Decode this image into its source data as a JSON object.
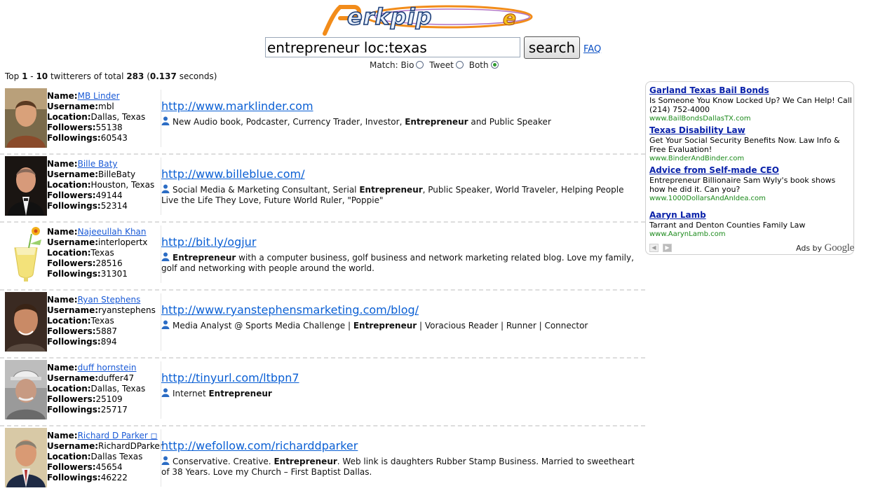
{
  "logo": {
    "text": "perkpipe"
  },
  "search": {
    "value": "entrepreneur loc:texas",
    "button_label": "search",
    "faq_label": "FAQ"
  },
  "match": {
    "label": "Match:",
    "options": [
      "Bio",
      "Tweet",
      "Both"
    ],
    "selected": "Both"
  },
  "summary": {
    "prefix": "Top",
    "start": "1",
    "dash": "-",
    "end": "10",
    "middle": "twitterers of total",
    "total": "283",
    "time": "0.137",
    "suffix": "seconds)"
  },
  "labels": {
    "name": "Name:",
    "username": "Username:",
    "location": "Location:",
    "followers": "Followers:",
    "followings": "Followings:"
  },
  "results": [
    {
      "name": "MB Linder",
      "username": "mbl",
      "location": "Dallas, Texas",
      "followers": "55138",
      "followings": "60543",
      "url": "http://www.marklinder.com",
      "bio_before": "New Audio book, Podcaster, Currency Trader, Investor, ",
      "bio_bold": "Entrepreneur",
      "bio_after": " and Public Speaker"
    },
    {
      "name": "Bille Baty",
      "username": "BilleBaty",
      "location": "Houston, Texas",
      "followers": "49144",
      "followings": "52314",
      "url": "http://www.billeblue.com/",
      "bio_before": "Social Media & Marketing Consultant, Serial ",
      "bio_bold": "Entrepreneur",
      "bio_after": ", Public Speaker, World Traveler, Helping People Live the Life They Love, Future World Ruler, \"Poppie\""
    },
    {
      "name": "Najeeullah Khan",
      "username": "interlopertx",
      "location": "Texas",
      "followers": "28516",
      "followings": "31301",
      "url": "http://bit.ly/ogjur",
      "bio_before": "",
      "bio_bold": "Entrepreneur",
      "bio_after": " with a computer business, golf business and network marketing related blog. Love my family, golf and networking with people around the world."
    },
    {
      "name": "Ryan Stephens",
      "username": "ryanstephens",
      "location": "Texas",
      "followers": "5887",
      "followings": "894",
      "url": "http://www.ryanstephensmarketing.com/blog/",
      "bio_before": "Media Analyst @ Sports Media Challenge | ",
      "bio_bold": "Entrepreneur",
      "bio_after": " | Voracious Reader | Runner | Connector"
    },
    {
      "name": "duff hornstein",
      "username": "duffer47",
      "location": "Dallas, Texas",
      "followers": "25109",
      "followings": "25717",
      "url": "http://tinyurl.com/ltbpn7",
      "bio_before": "Internet ",
      "bio_bold": "Entrepreneur",
      "bio_after": ""
    },
    {
      "name": "Richard D Parker ◻",
      "username": "RichardDParker",
      "location": "Dallas Texas",
      "followers": "45654",
      "followings": "46222",
      "url": "http://wefollow.com/richarddparker",
      "bio_before": "Conservative. Creative. ",
      "bio_bold": "Entrepreneur",
      "bio_after": ". Web link is daughters Rubber Stamp Business. Married to sweetheart of 38 Years. Love my Church – First Baptist Dallas."
    }
  ],
  "ads": [
    {
      "title": "Garland Texas Bail Bonds",
      "desc": "Is Someone You Know Locked Up? We Can Help! Call (214) 752-4000",
      "url": "www.BailBondsDallasTX.com"
    },
    {
      "title": "Texas Disability Law",
      "desc": "Get Your Social Security Benefits Now. Law Info & Free Evaluation!",
      "url": "www.BinderAndBinder.com"
    },
    {
      "title": "Advice from Self-made CEO",
      "desc": "Entrepreneur Billionaire Sam Wyly's book shows how he did it. Can you?",
      "url": "www.1000DollarsAndAnIdea.com"
    },
    {
      "title": "Aaryn Lamb",
      "desc": "Tarrant and Denton Counties Family Law",
      "url": "www.AarynLamb.com"
    }
  ],
  "ads_by": {
    "prefix": "Ads by",
    "brand": "Google"
  },
  "colors": {
    "link": "#0a5fd4",
    "ad_title": "#0a22aa",
    "ad_url": "#1b8a1b",
    "logo_orange": "#f28c1a",
    "logo_blue": "#2b5fa8"
  }
}
